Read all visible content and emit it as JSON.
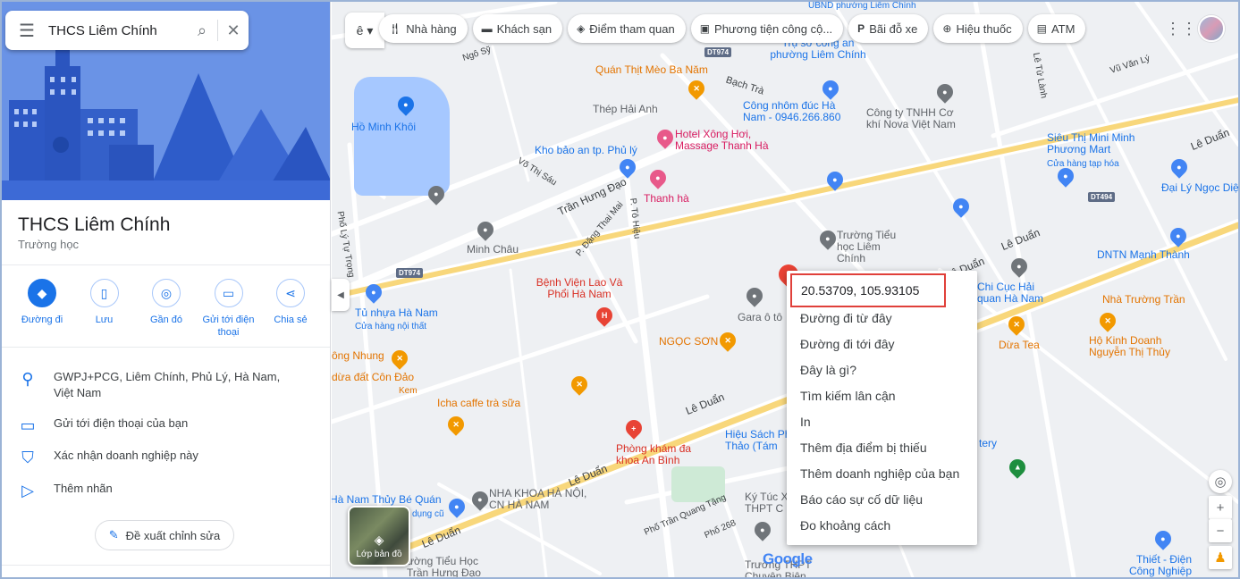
{
  "search": {
    "query": "THCS Liêm Chính"
  },
  "place": {
    "name": "THCS Liêm Chính",
    "category": "Trường học"
  },
  "actions": [
    {
      "label": "Đường đi"
    },
    {
      "label": "Lưu"
    },
    {
      "label": "Gần đó"
    },
    {
      "label": "Gửi tới điện thoại"
    },
    {
      "label": "Chia sẻ"
    }
  ],
  "info": {
    "address": "GWPJ+PCG, Liêm Chính, Phủ Lý, Hà Nam, Việt Nam",
    "send_phone": "Gửi tới điện thoại của bạn",
    "claim": "Xác nhận doanh nghiệp này",
    "label": "Thêm nhãn"
  },
  "suggest_edit": "Đề xuất chỉnh sửa",
  "chips": {
    "restaurants": "Nhà hàng",
    "hotels": "Khách sạn",
    "attractions": "Điểm tham quan",
    "transit": "Phương tiện công cộ...",
    "parking": "Bãi đỗ xe",
    "pharmacy": "Hiệu thuốc",
    "atm": "ATM"
  },
  "context_menu": {
    "coordinates": "20.53709, 105.93105",
    "items": [
      "Đường đi từ đây",
      "Đường đi tới đây",
      "Đây là gì?",
      "Tìm kiếm lân cận",
      "In",
      "Thêm địa điểm bị thiếu",
      "Thêm doanh nghiệp của bạn",
      "Báo cáo sự cố dữ liệu",
      "Đo khoảng cách"
    ]
  },
  "layers_label": "Lớp bản đồ",
  "map_labels": {
    "ubnd": "UBND phường Liêm Chính",
    "tru_so": "Trụ sở công an phường Liêm Chính",
    "quan_thit": "Quán Thịt Mèo Ba Năm",
    "bach_tra": "Bạch Trà",
    "thep": "Thép Hải Anh",
    "cong_nhom": "Công nhôm đúc Hà Nam - 0946.266.860",
    "nova": "Công ty TNHH Cơ khí Nova Việt Nam",
    "ho_minh_khoi": "Hồ Minh Khôi",
    "hotel": "Hotel Xông Hơi, Massage Thanh Hà",
    "kho_bao": "Kho bảo an tp. Phủ lý",
    "sieu_thi": "Siêu Thị Mini Minh Phương Mart",
    "sieu_thi_sub": "Cửa hàng tạp hóa",
    "dai_ly": "Đại Lý Ngọc Diệ",
    "thanh_ha": "Thanh hà",
    "truong_tieu_hoc": "Trường Tiểu học Liêm Chính",
    "minh_chau": "Minh Châu",
    "benh_vien": "Bệnh Viện Lao Và Phổi Hà Nam",
    "tu_nhua": "Tủ nhựa Hà Nam",
    "tu_nhua_sub": "Cửa hàng nội thất",
    "chi_cuc": "Chi Cục Hải quan Hà Nam",
    "dntn": "DNTN Mạnh Thành",
    "nha_truong_tran": "Nhà Trường Trần",
    "gara": "Gara ô tô",
    "ngoc_son": "NGỌC SƠN",
    "dua_tea": "Dừa Tea",
    "ho_kinh": "Hộ Kinh Doanh Nguyễn Thị Thủy",
    "nhung": "ông Nhung",
    "con_dao": "dừa đất Côn Đảo",
    "con_dao_sub": "Kem",
    "icha": "Icha caffe trà sữa",
    "phong_kham": "Phòng khám đa khoa An Bình",
    "hieu_sach": "Hiệu Sách Ph Thảo (Tám",
    "tery": "tery",
    "thuy_be": "Hà Nam Thủy Bé Quán",
    "thuy_be_sub": "dụng cũ",
    "nha_khoa": "NHA KHOA HÀ NỘI, CN HÀ NAM",
    "ky_tuc": "Ký Túc X THPT C",
    "thiet": "Thiết - Điện Công Nghiệp",
    "truong_thpt": "Trường THPT Chuyên Biên Hoà",
    "truong_tieu_hoc_bottom": "ường Tiểu Học Trần Hưng Đạo",
    "google": "Google",
    "le_duan_1": "Lê Duẩn",
    "le_duan_2": "Lê Duẩn",
    "le_duan_3": "Lê Duẩn",
    "le_duan_4": "Lê Duẩn",
    "le_duan_5": "Lê Duẩn",
    "le_duan_6": "Lê Duẩn",
    "tran_hung_dao": "Trần Hưng Đạo",
    "vo_thi_sau": "Võ Thị Sáu",
    "dang_thai_mai": "P. Đặng Thai Mai",
    "to_hieu": "P. Tô Hiệu",
    "ly_tu_trong": "Phố Lý Tự Trọng",
    "tran_quang_tang": "Phố Trần Quang Tặng",
    "pho_268": "Phố 268",
    "vu_van_ly": "Vũ Văn Lý",
    "le_tu_lanh": "Lê Tử Lành",
    "ngo_sy": "Ngô Sỹ",
    "dt974_a": "DT974",
    "dt974_b": "DT974",
    "dt494": "DT494"
  }
}
